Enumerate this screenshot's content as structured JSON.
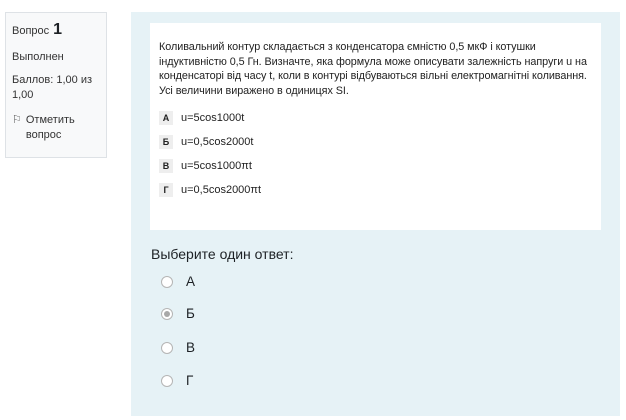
{
  "info": {
    "question_label": "Вопрос",
    "question_number": "1",
    "state": "Выполнен",
    "grade": "Баллов: 1,00 из 1,00",
    "flag_label": "Отметить вопрос"
  },
  "question": {
    "text": "Коливальний контур складається з конденсатора ємністю 0,5 мкФ і котушки індуктивністю 0,5 Гн. Визначте, яка формула може описувати залежність напруги u на конденсаторі від часу t, коли в контурі відбуваються вільні електромагнітні коливання. Усі величини виражено в одиницях SI.",
    "options": [
      {
        "letter": "А",
        "formula": "u=5cos1000t"
      },
      {
        "letter": "Б",
        "formula": "u=0,5cos2000t"
      },
      {
        "letter": "В",
        "formula": "u=5cos1000πt"
      },
      {
        "letter": "Г",
        "formula": "u=0,5cos2000πt"
      }
    ]
  },
  "prompt": "Выберите один ответ:",
  "answers": [
    {
      "label": "А",
      "selected": false
    },
    {
      "label": "Б",
      "selected": true
    },
    {
      "label": "В",
      "selected": false
    },
    {
      "label": "Г",
      "selected": false
    }
  ]
}
